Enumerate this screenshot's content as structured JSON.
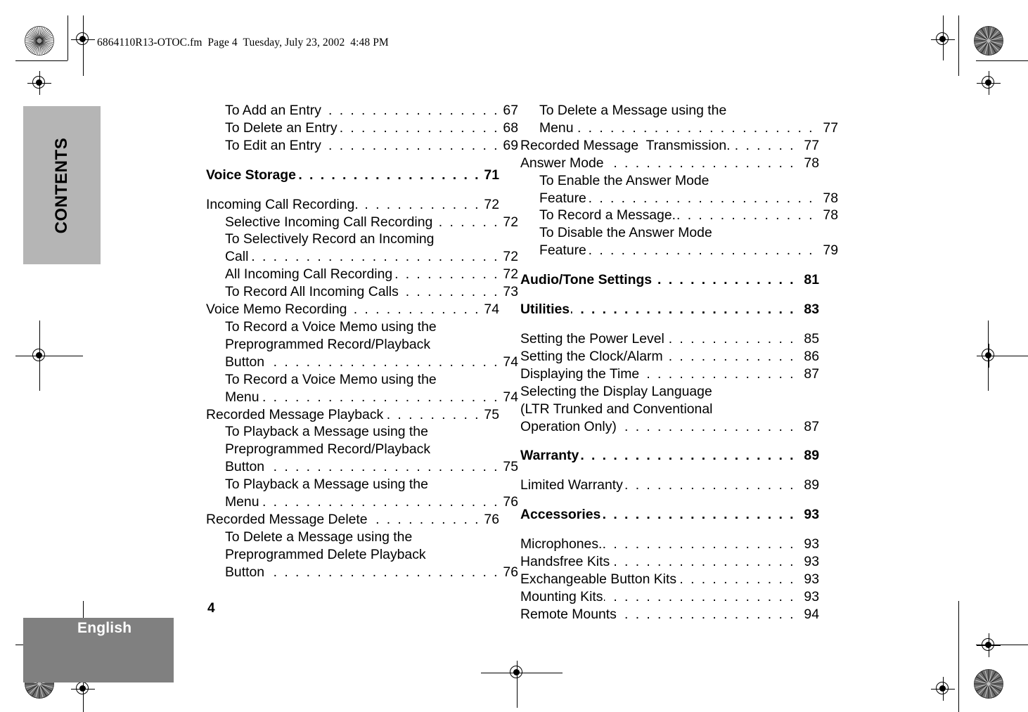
{
  "file_header": "6864110R13-OTOC.fm  Page 4  Tuesday, July 23, 2002  4:48 PM",
  "side_tab": {
    "label": "CONTENTS"
  },
  "footer": {
    "language": "English",
    "page_number": "4"
  },
  "colors": {
    "side_tab_gray": "#b5b5b5",
    "footer_gray": "#808080",
    "text": "#000000",
    "footer_label": "#ffffff"
  },
  "toc": {
    "left_column": [
      {
        "text": "To Add an Entry",
        "page": "67",
        "level": 2,
        "bold": false,
        "cont": false
      },
      {
        "text": "To Delete an Entry",
        "page": "68",
        "level": 2,
        "bold": false,
        "cont": false
      },
      {
        "text": "To Edit an Entry",
        "page": "69",
        "level": 2,
        "bold": false,
        "cont": false
      },
      {
        "text": "Voice Storage",
        "page": "71",
        "level": 1,
        "bold": true,
        "cont": false,
        "gap_before": true,
        "gap_after": true
      },
      {
        "text": "Incoming Call Recording.",
        "page": "72",
        "level": 1,
        "bold": false,
        "cont": false
      },
      {
        "text": "Selective Incoming Call Recording",
        "page": "72",
        "level": 2,
        "bold": false,
        "cont": false
      },
      {
        "text": "To Selectively Record an Incoming",
        "page": "",
        "level": 2,
        "bold": false,
        "cont": true
      },
      {
        "text": "Call",
        "page": "72",
        "level": 2,
        "bold": false,
        "cont": false
      },
      {
        "text": "All Incoming Call Recording",
        "page": "72",
        "level": 2,
        "bold": false,
        "cont": false
      },
      {
        "text": "To Record All Incoming Calls",
        "page": "73",
        "level": 2,
        "bold": false,
        "cont": false
      },
      {
        "text": "Voice Memo Recording",
        "page": "74",
        "level": 1,
        "bold": false,
        "cont": false
      },
      {
        "text": "To Record a Voice Memo using the",
        "page": "",
        "level": 2,
        "bold": false,
        "cont": true
      },
      {
        "text": "Preprogrammed Record/Playback",
        "page": "",
        "level": 2,
        "bold": false,
        "cont": true
      },
      {
        "text": "Button",
        "page": "74",
        "level": 2,
        "bold": false,
        "cont": false
      },
      {
        "text": "To Record a Voice Memo using the",
        "page": "",
        "level": 2,
        "bold": false,
        "cont": true
      },
      {
        "text": "Menu",
        "page": "74",
        "level": 2,
        "bold": false,
        "cont": false
      },
      {
        "text": "Recorded Message Playback",
        "page": "75",
        "level": 1,
        "bold": false,
        "cont": false
      },
      {
        "text": "To Playback a Message using the",
        "page": "",
        "level": 2,
        "bold": false,
        "cont": true
      },
      {
        "text": "Preprogrammed Record/Playback",
        "page": "",
        "level": 2,
        "bold": false,
        "cont": true
      },
      {
        "text": "Button",
        "page": "75",
        "level": 2,
        "bold": false,
        "cont": false
      },
      {
        "text": "To Playback a Message using the",
        "page": "",
        "level": 2,
        "bold": false,
        "cont": true
      },
      {
        "text": "Menu",
        "page": "76",
        "level": 2,
        "bold": false,
        "cont": false
      },
      {
        "text": "Recorded Message Delete",
        "page": "76",
        "level": 1,
        "bold": false,
        "cont": false
      },
      {
        "text": "To Delete a Message using the",
        "page": "",
        "level": 2,
        "bold": false,
        "cont": true
      },
      {
        "text": "Preprogrammed Delete Playback",
        "page": "",
        "level": 2,
        "bold": false,
        "cont": true
      },
      {
        "text": "Button",
        "page": "76",
        "level": 2,
        "bold": false,
        "cont": false
      }
    ],
    "right_column": [
      {
        "text": "To Delete a Message using the",
        "page": "",
        "level": 2,
        "bold": false,
        "cont": true
      },
      {
        "text": "Menu",
        "page": "77",
        "level": 2,
        "bold": false,
        "cont": false
      },
      {
        "text": "Recorded Message  Transmission.",
        "page": "77",
        "level": 1,
        "bold": false,
        "cont": false
      },
      {
        "text": "Answer Mode",
        "page": "78",
        "level": 1,
        "bold": false,
        "cont": false
      },
      {
        "text": "To Enable the Answer Mode",
        "page": "",
        "level": 2,
        "bold": false,
        "cont": true
      },
      {
        "text": "Feature",
        "page": "78",
        "level": 2,
        "bold": false,
        "cont": false
      },
      {
        "text": "To Record a Message.",
        "page": "78",
        "level": 2,
        "bold": false,
        "cont": false
      },
      {
        "text": "To Disable the Answer Mode",
        "page": "",
        "level": 2,
        "bold": false,
        "cont": true
      },
      {
        "text": "Feature",
        "page": "79",
        "level": 2,
        "bold": false,
        "cont": false
      },
      {
        "text": "Audio/Tone Settings",
        "page": "81",
        "level": 1,
        "bold": true,
        "cont": false,
        "gap_before": true,
        "gap_after": true
      },
      {
        "text": "Utilities",
        "page": "83",
        "level": 1,
        "bold": true,
        "cont": false,
        "gap_after": true
      },
      {
        "text": "Setting the Power Level",
        "page": "85",
        "level": 1,
        "bold": false,
        "cont": false
      },
      {
        "text": "Setting the Clock/Alarm",
        "page": "86",
        "level": 1,
        "bold": false,
        "cont": false
      },
      {
        "text": "Displaying the Time",
        "page": "87",
        "level": 1,
        "bold": false,
        "cont": false
      },
      {
        "text": "Selecting the Display Language",
        "page": "",
        "level": 1,
        "bold": false,
        "cont": true
      },
      {
        "text": "(LTR Trunked and Conventional",
        "page": "",
        "level": 1,
        "bold": false,
        "cont": true
      },
      {
        "text": "Operation Only)",
        "page": "87",
        "level": 1,
        "bold": false,
        "cont": false
      },
      {
        "text": "Warranty",
        "page": "89",
        "level": 1,
        "bold": true,
        "cont": false,
        "gap_before": true,
        "gap_after": true
      },
      {
        "text": "Limited Warranty",
        "page": "89",
        "level": 1,
        "bold": false,
        "cont": false
      },
      {
        "text": "Accessories",
        "page": "93",
        "level": 1,
        "bold": true,
        "cont": false,
        "gap_before": true,
        "gap_after": true
      },
      {
        "text": "Microphones.",
        "page": "93",
        "level": 1,
        "bold": false,
        "cont": false
      },
      {
        "text": "Handsfree Kits",
        "page": "93",
        "level": 1,
        "bold": false,
        "cont": false
      },
      {
        "text": "Exchangeable Button Kits",
        "page": "93",
        "level": 1,
        "bold": false,
        "cont": false
      },
      {
        "text": "Mounting Kits",
        "page": "93",
        "level": 1,
        "bold": false,
        "cont": false
      },
      {
        "text": "Remote Mounts",
        "page": "94",
        "level": 1,
        "bold": false,
        "cont": false
      }
    ]
  },
  "print_marks": {
    "registration_target": "registration-target-icon",
    "starburst": "starburst-density-icon"
  }
}
